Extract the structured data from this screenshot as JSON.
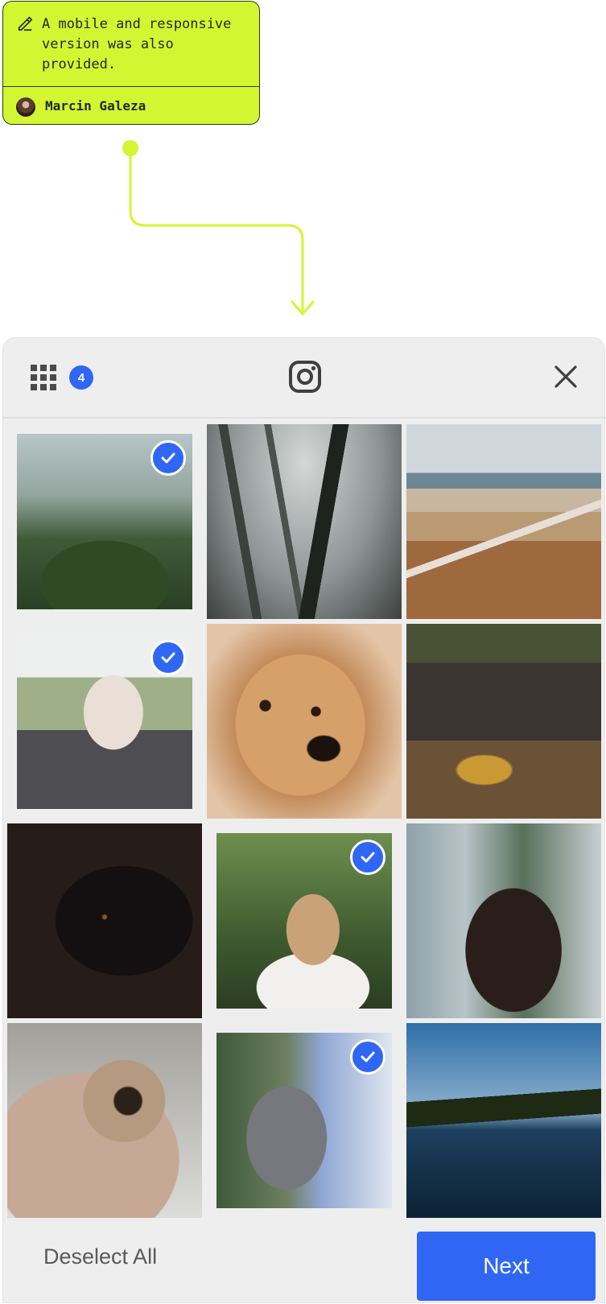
{
  "note": {
    "text": "A mobile and responsive version was also provided.",
    "author": "Marcin Galeza",
    "icon": "pencil-icon"
  },
  "header": {
    "grid_icon": "grid-icon",
    "selected_count": "4",
    "center_icon": "instagram-icon",
    "close_icon": "close-icon"
  },
  "photos": [
    {
      "subject": "woman in greenhouse",
      "selected": true
    },
    {
      "subject": "foggy forest",
      "selected": false
    },
    {
      "subject": "beach path with fence",
      "selected": false
    },
    {
      "subject": "woman with blanket",
      "selected": true
    },
    {
      "subject": "fluffy dog",
      "selected": false
    },
    {
      "subject": "legs with boots",
      "selected": false
    },
    {
      "subject": "black dog",
      "selected": false
    },
    {
      "subject": "blonde girl",
      "selected": true
    },
    {
      "subject": "woman with dark hair",
      "selected": false
    },
    {
      "subject": "pug in blanket",
      "selected": false
    },
    {
      "subject": "french bulldog puppy",
      "selected": true
    },
    {
      "subject": "sea and island",
      "selected": false
    }
  ],
  "footer": {
    "deselect_label": "Deselect All",
    "next_label": "Next"
  },
  "colors": {
    "accent": "#2f66f4",
    "note_bg": "#d4f532",
    "connector": "#d4f532"
  }
}
